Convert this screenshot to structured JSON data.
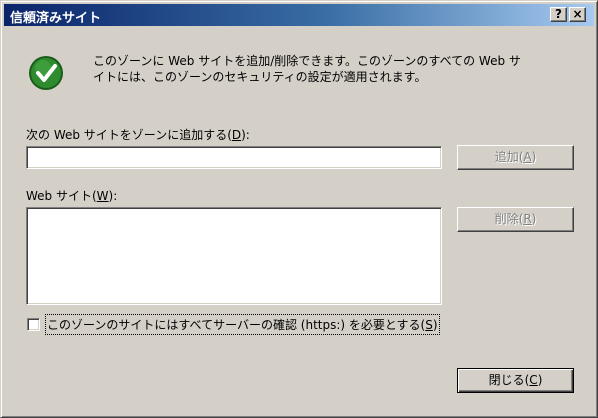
{
  "window": {
    "title": "信頼済みサイト",
    "help_button": "?",
    "close_button": "×"
  },
  "info": {
    "icon": "check-icon",
    "line1": "このゾーンに Web サイトを追加/削除できます。このゾーンのすべての Web サ",
    "line2": "イトには、このゾーンのセキュリティの設定が適用されます。"
  },
  "add_site": {
    "label_before": "次の Web サイトをゾーンに追加する(",
    "mnemonic": "D",
    "label_after": "):",
    "value": "",
    "button": {
      "before": "追加(",
      "mnemonic": "A",
      "after": ")",
      "enabled": false
    }
  },
  "sites": {
    "label_before": "Web サイト(",
    "mnemonic": "W",
    "label_after": "):",
    "items": [],
    "remove_button": {
      "before": "削除(",
      "mnemonic": "R",
      "after": ")",
      "enabled": false
    }
  },
  "require_https": {
    "label_before": "このゾーンのサイトにはすべてサーバーの確認 (https:) を必要とする(",
    "mnemonic": "S",
    "label_after": ")",
    "checked": false
  },
  "close_dialog": {
    "before": "閉じる(",
    "mnemonic": "C",
    "after": ")"
  },
  "colors": {
    "face": "#d4d0c8",
    "title_start": "#0a246a",
    "title_end": "#a6caf0",
    "icon_green": "#1f7a1f"
  }
}
